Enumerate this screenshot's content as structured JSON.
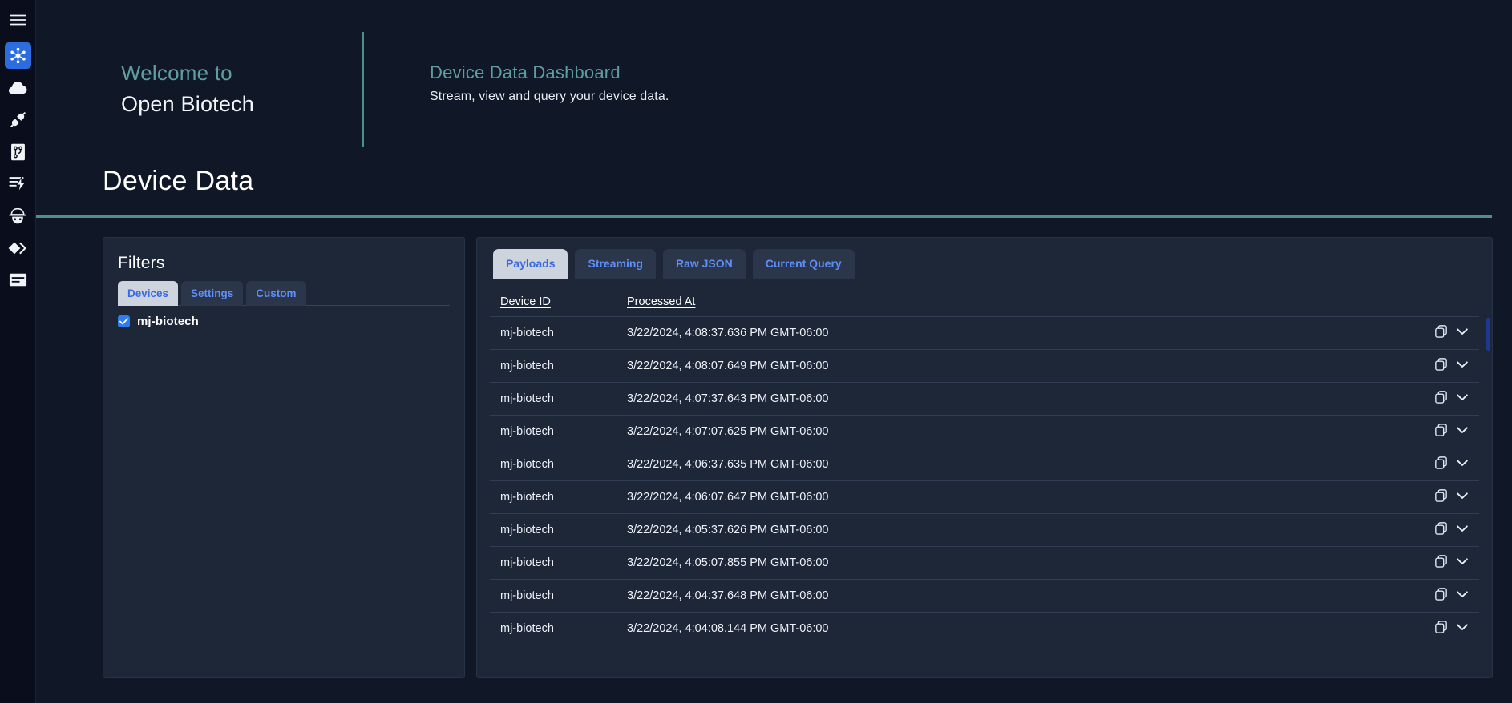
{
  "rail": {
    "items": [
      {
        "name": "menu-icon",
        "label": "Menu",
        "active": false
      },
      {
        "name": "hub-network-icon",
        "label": "Network",
        "active": true
      },
      {
        "name": "cloud-icon",
        "label": "Cloud",
        "active": false
      },
      {
        "name": "plug-connect-icon",
        "label": "Connections",
        "active": false
      },
      {
        "name": "branch-document-icon",
        "label": "Pipelines",
        "active": false
      },
      {
        "name": "lightning-activity-icon",
        "label": "Activity",
        "active": false
      },
      {
        "name": "incognito-icon",
        "label": "Privacy",
        "active": false
      },
      {
        "name": "diamonds-icon",
        "label": "Data",
        "active": false
      },
      {
        "name": "list-document-icon",
        "label": "Logs",
        "active": false
      }
    ]
  },
  "hero": {
    "welcome_to": "Welcome to",
    "brand": "Open Biotech",
    "dashboard_title": "Device Data Dashboard",
    "dashboard_subtitle": "Stream, view and query your device data."
  },
  "page": {
    "title": "Device Data"
  },
  "filters": {
    "heading": "Filters",
    "tabs": [
      {
        "label": "Devices",
        "active": true
      },
      {
        "label": "Settings",
        "active": false
      },
      {
        "label": "Custom",
        "active": false
      }
    ],
    "devices": [
      {
        "label": "mj-biotech",
        "checked": true
      }
    ]
  },
  "data_panel": {
    "tabs": [
      {
        "label": "Payloads",
        "active": true
      },
      {
        "label": "Streaming",
        "active": false
      },
      {
        "label": "Raw JSON",
        "active": false
      },
      {
        "label": "Current Query",
        "active": false
      }
    ],
    "columns": [
      "Device ID",
      "Processed At"
    ],
    "row_actions": {
      "copy": "copy-icon",
      "expand": "chevron-down-icon"
    },
    "rows": [
      {
        "device_id": "mj-biotech",
        "processed_at": "3/22/2024, 4:08:37.636 PM GMT-06:00"
      },
      {
        "device_id": "mj-biotech",
        "processed_at": "3/22/2024, 4:08:07.649 PM GMT-06:00"
      },
      {
        "device_id": "mj-biotech",
        "processed_at": "3/22/2024, 4:07:37.643 PM GMT-06:00"
      },
      {
        "device_id": "mj-biotech",
        "processed_at": "3/22/2024, 4:07:07.625 PM GMT-06:00"
      },
      {
        "device_id": "mj-biotech",
        "processed_at": "3/22/2024, 4:06:37.635 PM GMT-06:00"
      },
      {
        "device_id": "mj-biotech",
        "processed_at": "3/22/2024, 4:06:07.647 PM GMT-06:00"
      },
      {
        "device_id": "mj-biotech",
        "processed_at": "3/22/2024, 4:05:37.626 PM GMT-06:00"
      },
      {
        "device_id": "mj-biotech",
        "processed_at": "3/22/2024, 4:05:07.855 PM GMT-06:00"
      },
      {
        "device_id": "mj-biotech",
        "processed_at": "3/22/2024, 4:04:37.648 PM GMT-06:00"
      },
      {
        "device_id": "mj-biotech",
        "processed_at": "3/22/2024, 4:04:08.144 PM GMT-06:00"
      }
    ]
  },
  "colors": {
    "page_bg": "#101827",
    "rail_bg": "#0a0e1c",
    "card_bg": "#1d2738",
    "accent_teal": "#4c8f8d",
    "accent_blue": "#2f7df0",
    "tab_active_bg": "#ced4de",
    "tab_text": "#5e8ef7",
    "scrollbar": "#1b3a8f"
  }
}
